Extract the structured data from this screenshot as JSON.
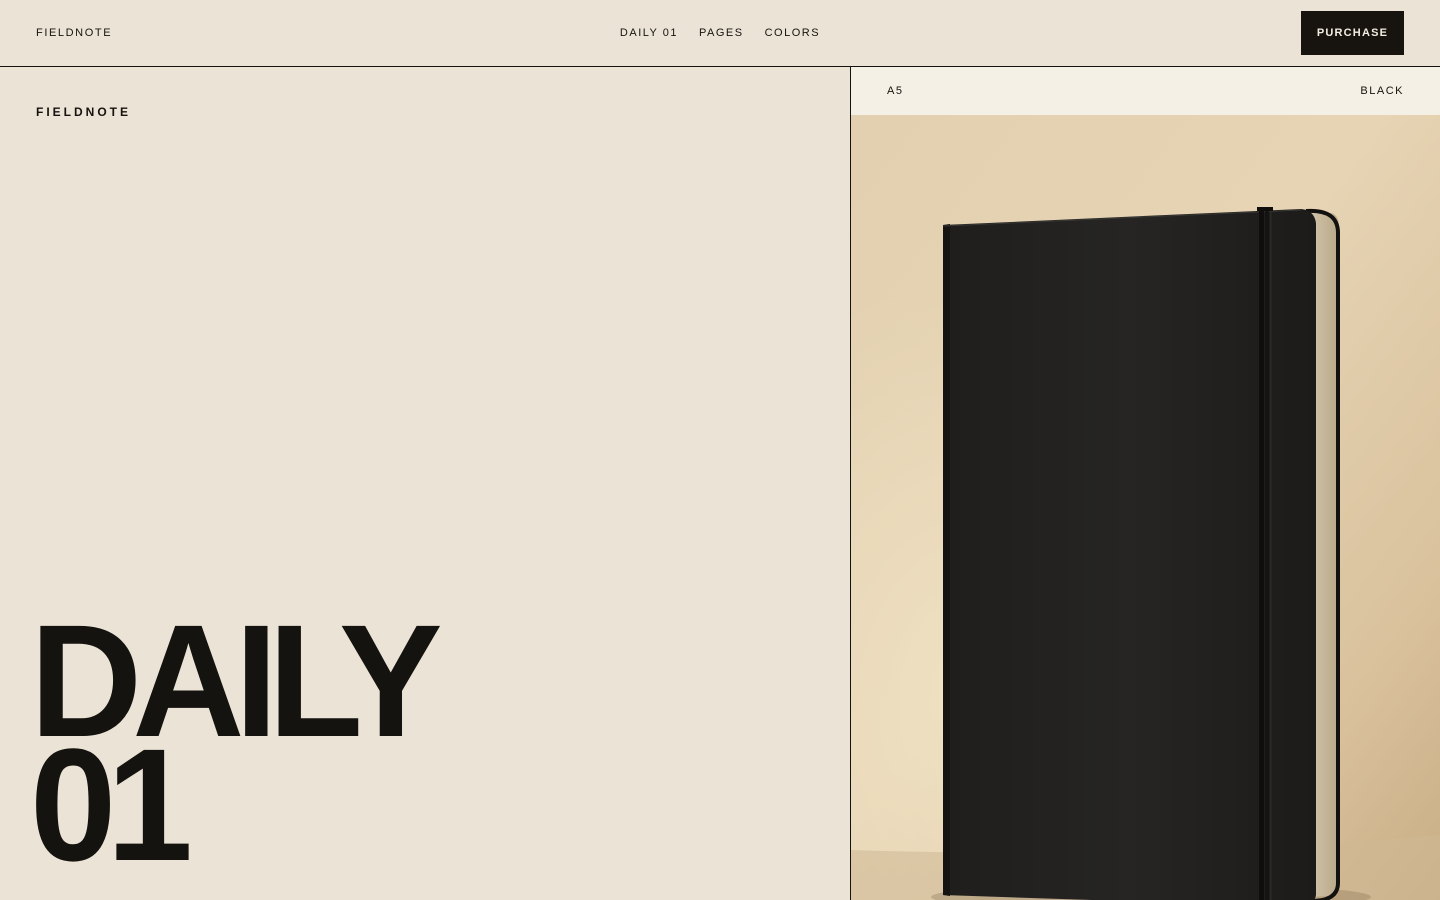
{
  "header": {
    "brand": "FIELDNOTE",
    "nav": [
      "DAILY 01",
      "PAGES",
      "COLORS"
    ],
    "cta": "PURCHASE"
  },
  "hero": {
    "eyebrow": "FIELDNOTE",
    "title_line1": "DAILY",
    "title_line2": "01"
  },
  "product": {
    "size": "A5",
    "color": "BLACK",
    "image": "black-hardcover-notebook"
  },
  "colors": {
    "background": "#EBE3D6",
    "ink": "#15130F",
    "spec_bar": "#F5F0E6"
  }
}
